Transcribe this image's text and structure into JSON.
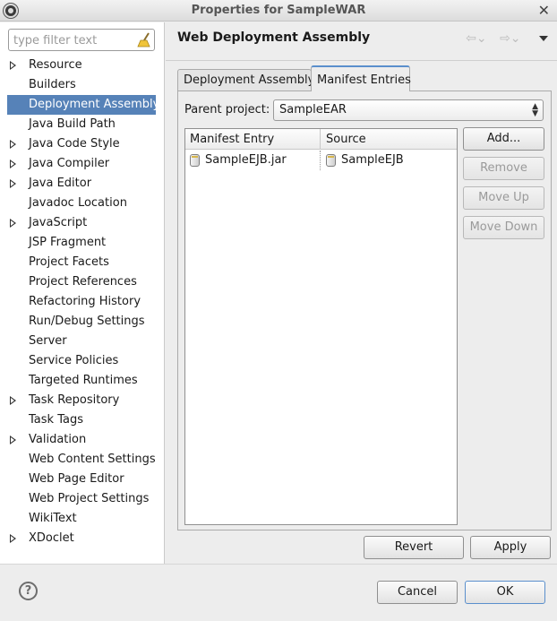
{
  "window": {
    "title": "Properties for SampleWAR"
  },
  "filter": {
    "placeholder": "type filter text"
  },
  "tree": [
    {
      "label": "Resource",
      "expandable": true
    },
    {
      "label": "Builders",
      "expandable": false
    },
    {
      "label": "Deployment Assembly",
      "expandable": false,
      "selected": true
    },
    {
      "label": "Java Build Path",
      "expandable": false
    },
    {
      "label": "Java Code Style",
      "expandable": true
    },
    {
      "label": "Java Compiler",
      "expandable": true
    },
    {
      "label": "Java Editor",
      "expandable": true
    },
    {
      "label": "Javadoc Location",
      "expandable": false
    },
    {
      "label": "JavaScript",
      "expandable": true
    },
    {
      "label": "JSP Fragment",
      "expandable": false
    },
    {
      "label": "Project Facets",
      "expandable": false
    },
    {
      "label": "Project References",
      "expandable": false
    },
    {
      "label": "Refactoring History",
      "expandable": false
    },
    {
      "label": "Run/Debug Settings",
      "expandable": false
    },
    {
      "label": "Server",
      "expandable": false
    },
    {
      "label": "Service Policies",
      "expandable": false
    },
    {
      "label": "Targeted Runtimes",
      "expandable": false
    },
    {
      "label": "Task Repository",
      "expandable": true
    },
    {
      "label": "Task Tags",
      "expandable": false
    },
    {
      "label": "Validation",
      "expandable": true
    },
    {
      "label": "Web Content Settings",
      "expandable": false
    },
    {
      "label": "Web Page Editor",
      "expandable": false
    },
    {
      "label": "Web Project Settings",
      "expandable": false
    },
    {
      "label": "WikiText",
      "expandable": false
    },
    {
      "label": "XDoclet",
      "expandable": true
    }
  ],
  "page": {
    "title": "Web Deployment Assembly",
    "tabs": [
      {
        "label": "Deployment Assembly",
        "active": false
      },
      {
        "label": "Manifest Entries",
        "active": true
      }
    ],
    "parent_label": "Parent project:",
    "parent_value": "SampleEAR",
    "table": {
      "headers": [
        "Manifest Entry",
        "Source"
      ],
      "rows": [
        [
          "SampleEJB.jar",
          "SampleEJB"
        ]
      ]
    },
    "buttons": {
      "add": "Add...",
      "remove": "Remove",
      "move_up": "Move Up",
      "move_down": "Move Down",
      "revert": "Revert",
      "apply": "Apply"
    }
  },
  "dialog": {
    "cancel": "Cancel",
    "ok": "OK"
  },
  "colors": {
    "selection": "#5682b8",
    "tab_accent": "#5a8fcc"
  }
}
